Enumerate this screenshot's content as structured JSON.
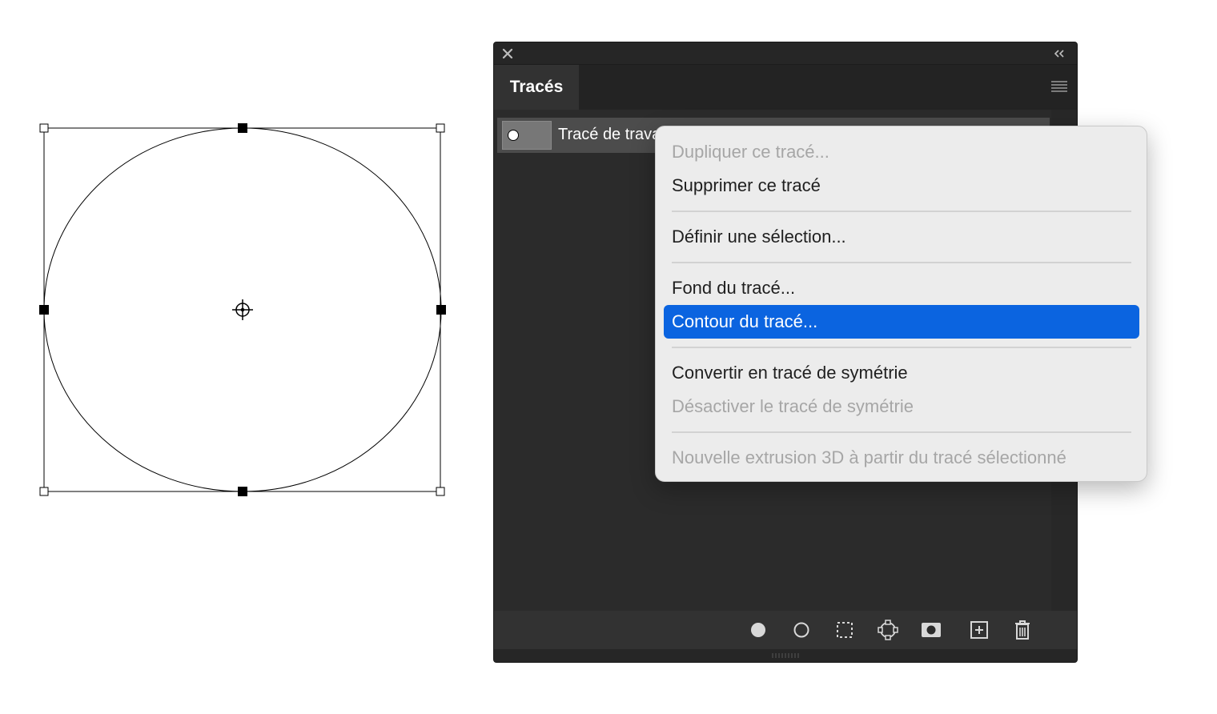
{
  "panel": {
    "tab_label": "Tracés",
    "path_row_label": "Tracé de travail",
    "icons": {
      "close": "close-icon",
      "collapse": "double-chevron-left-icon",
      "menu": "hamburger-menu-icon"
    },
    "footer_buttons": [
      {
        "name": "fill-path-icon"
      },
      {
        "name": "stroke-path-icon"
      },
      {
        "name": "load-selection-icon"
      },
      {
        "name": "make-path-from-selection-icon"
      },
      {
        "name": "add-mask-icon"
      },
      {
        "name": "new-path-icon"
      },
      {
        "name": "delete-path-icon"
      }
    ]
  },
  "context_menu": {
    "items": [
      {
        "label": "Dupliquer ce tracé...",
        "state": "disabled"
      },
      {
        "label": "Supprimer ce tracé",
        "state": "enabled"
      },
      {
        "label": "Définir une sélection...",
        "state": "enabled"
      },
      {
        "label": "Fond du tracé...",
        "state": "enabled"
      },
      {
        "label": "Contour du tracé...",
        "state": "highlighted"
      },
      {
        "label": "Convertir en tracé de symétrie",
        "state": "enabled"
      },
      {
        "label": "Désactiver le tracé de symétrie",
        "state": "disabled"
      },
      {
        "label": "Nouvelle extrusion 3D à partir du tracé sélectionné",
        "state": "disabled"
      }
    ]
  },
  "colors": {
    "panel_bg": "#2b2b2b",
    "menu_bg": "#ececec",
    "highlight": "#0b64e0",
    "disabled_text": "#a6a6a6"
  }
}
